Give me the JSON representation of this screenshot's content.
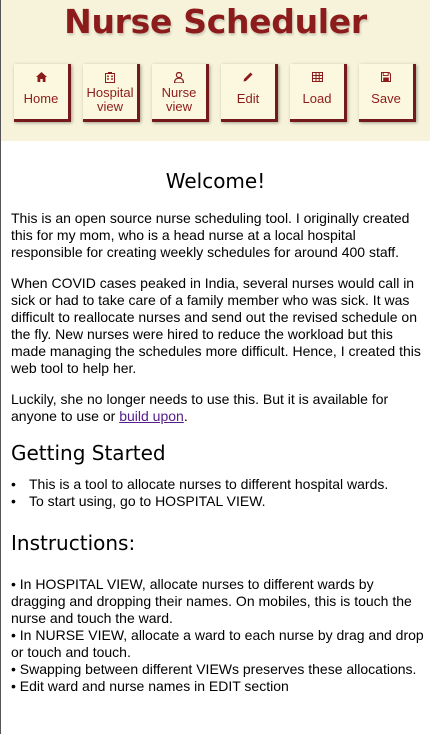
{
  "app": {
    "title": "Nurse Scheduler"
  },
  "nav": {
    "home": {
      "label": "Home",
      "icon": "home-icon"
    },
    "hospital_view": {
      "label_line1": "Hospital",
      "label_line2": "view",
      "icon": "hospital-icon"
    },
    "nurse_view": {
      "label_line1": "Nurse",
      "label_line2": "view",
      "icon": "nurse-icon"
    },
    "edit": {
      "label": "Edit",
      "icon": "pencil-icon"
    },
    "load": {
      "label": "Load",
      "icon": "table-icon"
    },
    "save": {
      "label": "Save",
      "icon": "floppy-disk-icon"
    }
  },
  "colors": {
    "brand": "#8c1c1c",
    "header_bg": "#f6f3da",
    "button_bg": "#fcf8df",
    "button_border": "#741a1a",
    "link": "#551a8b"
  },
  "welcome": {
    "heading": "Welcome!",
    "paragraph1": "This is an open source nurse scheduling tool. I originally created this for my mom, who is a head nurse at a local hospital responsible for creating weekly schedules for around 400 staff.",
    "paragraph2": "When COVID cases peaked in India, several nurses would call in sick or had to take care of a family member who was sick. It was difficult to reallocate nurses and send out the revised schedule on the fly. New nurses were hired to reduce the workload but this made managing the schedules more difficult. Hence, I created this web tool to help her.",
    "paragraph3_before": "Luckily, she no longer needs to use this. But it is available for anyone to use or ",
    "paragraph3_link": "build upon",
    "paragraph3_after": "."
  },
  "getting_started": {
    "heading": "Getting Started",
    "items": [
      "This is a tool to allocate nurses to different hospital wards.",
      "To start using, go to HOSPITAL VIEW."
    ]
  },
  "instructions": {
    "heading": "Instructions:",
    "items": [
      "•  In HOSPITAL VIEW, allocate nurses to different wards by dragging and dropping their names. On mobiles, this is touch the nurse and touch the ward.",
      "•  In NURSE VIEW, allocate a ward to each nurse by drag and drop or touch and touch.",
      "•  Swapping between different VIEWs preserves these allocations.",
      "•  Edit ward and nurse names in EDIT section"
    ]
  }
}
